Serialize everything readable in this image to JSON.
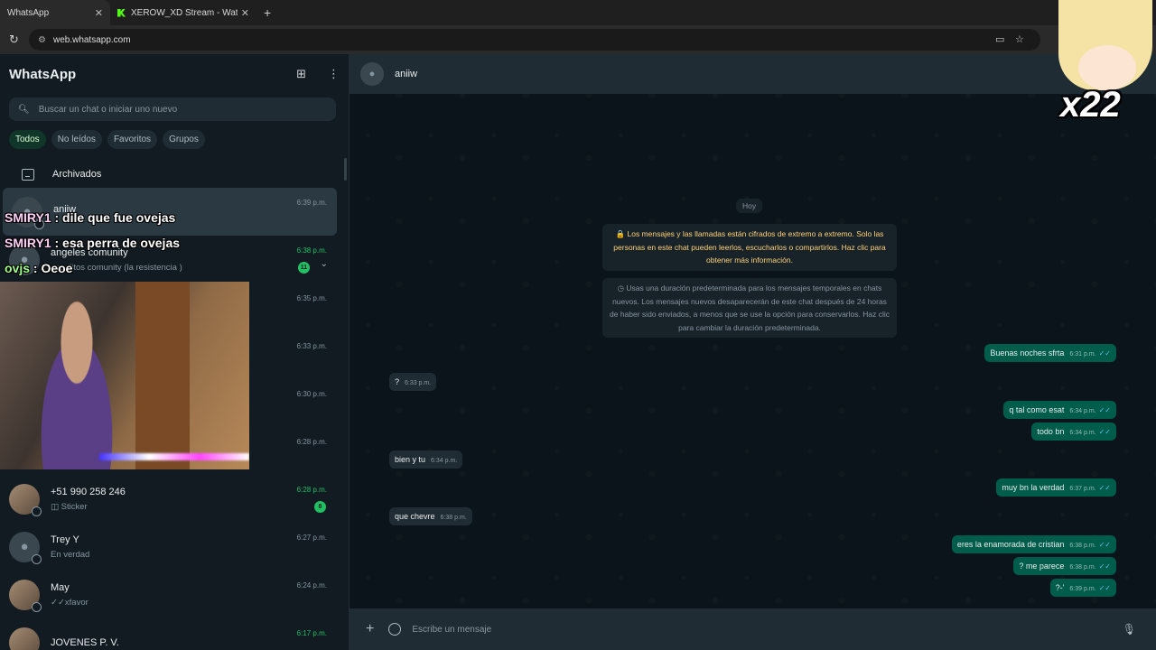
{
  "browser": {
    "tabs": [
      {
        "title": "WhatsApp"
      },
      {
        "title": "XEROW_XD Stream - Watch Liv"
      }
    ],
    "url": "web.whatsapp.com"
  },
  "sidebar": {
    "title": "WhatsApp",
    "search_placeholder": "Buscar un chat o iniciar uno nuevo",
    "filters": [
      "Todos",
      "No leídos",
      "Favoritos",
      "Grupos"
    ],
    "archived_label": "Archivados",
    "chats": [
      {
        "name": "aniiw",
        "preview": "",
        "time": "6:39 p.m.",
        "unread": ""
      },
      {
        "name": "angeles comunity",
        "preview": "angelitos comunity (la resistencia )",
        "time": "6:38 p.m.",
        "unread": "11"
      },
      {
        "name": "",
        "preview": "",
        "time": "6:35 p.m.",
        "unread": ""
      },
      {
        "name": "",
        "preview": "",
        "time": "6:33 p.m.",
        "unread": ""
      },
      {
        "name": "",
        "preview": "",
        "time": "6:30 p.m.",
        "unread": ""
      },
      {
        "name": "",
        "preview": "",
        "time": "6:28 p.m.",
        "unread": ""
      },
      {
        "name": "+51 990 258 246",
        "preview": "Sticker",
        "time": "6:28 p.m.",
        "unread": "8"
      },
      {
        "name": "Trey Y",
        "preview": "En verdad",
        "time": "6:27 p.m.",
        "unread": ""
      },
      {
        "name": "May",
        "preview": "✓✓xfavor",
        "time": "6:24 p.m.",
        "unread": ""
      },
      {
        "name": "JOVENES P. V.",
        "preview": "",
        "time": "6:17 p.m.",
        "unread": ""
      }
    ]
  },
  "conversation": {
    "contact": "aniiw",
    "day": "Hoy",
    "encryption_notice": "🔒 Los mensajes y las llamadas están cifrados de extremo a extremo. Solo las personas en este chat pueden leerlos, escucharlos o compartirlos. Haz clic para obtener más información.",
    "ephemeral_notice": "Usas una duración predeterminada para los mensajes temporales en chats nuevos. Los mensajes nuevos desaparecerán de este chat después de 24 horas de haber sido enviados, a menos que se use la opción para conservarlos. Haz clic para cambiar la duración predeterminada.",
    "messages": [
      {
        "dir": "out",
        "text": "Buenas noches sfrta",
        "time": "6:31 p.m."
      },
      {
        "dir": "in",
        "text": "?",
        "time": "6:33 p.m."
      },
      {
        "dir": "out",
        "text": "q tal como esat",
        "time": "6:34 p.m."
      },
      {
        "dir": "out",
        "text": "todo bn",
        "time": "6:34 p.m."
      },
      {
        "dir": "in",
        "text": "bien y tu",
        "time": "6:34 p.m."
      },
      {
        "dir": "out",
        "text": "muy bn la verdad",
        "time": "6:37 p.m."
      },
      {
        "dir": "in",
        "text": "que chevre",
        "time": "6:38 p.m."
      },
      {
        "dir": "out",
        "text": "eres la enamorada de cristian",
        "time": "6:38 p.m."
      },
      {
        "dir": "out",
        "text": "? me parece",
        "time": "6:38 p.m."
      },
      {
        "dir": "out",
        "text": "?-'",
        "time": "6:39 p.m."
      }
    ],
    "composer_placeholder": "Escribe un mensaje"
  },
  "stream_overlay": {
    "chat_lines": [
      {
        "user": "SMIRY1",
        "text": " : dile que fue ovejas"
      },
      {
        "user": "SMIRY1",
        "text": " : esa perra de ovejas"
      },
      {
        "user": "ovjs",
        "text": " : Oeoe"
      }
    ],
    "sticker_text": "x22"
  }
}
